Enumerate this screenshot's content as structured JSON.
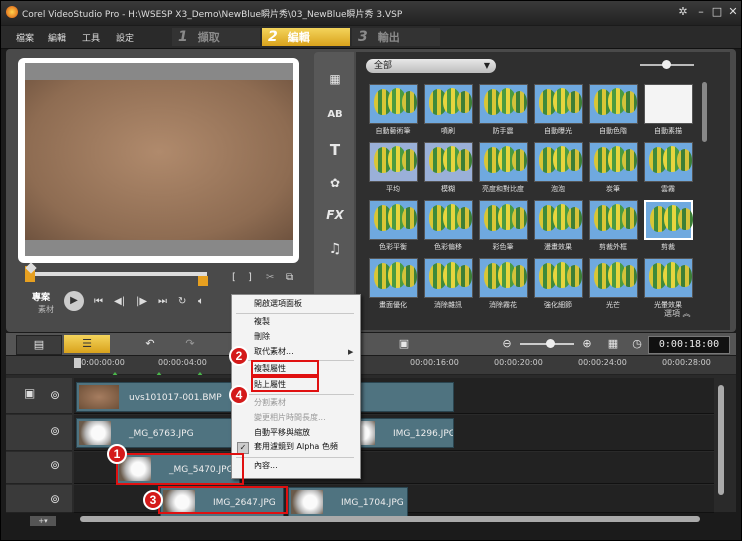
{
  "window": {
    "title": "Corel VideoStudio Pro - H:\\WSESP X3_Demo\\NewBlue瞬片秀\\03_NewBlue瞬片秀 3.VSP",
    "buttons": [
      "app-icon",
      "minimize-icon",
      "maximize-icon",
      "close-icon"
    ]
  },
  "menu": {
    "items": [
      "檔案",
      "編輯",
      "工具",
      "設定"
    ]
  },
  "steps": [
    {
      "num": "1",
      "label": "擷取",
      "active": false
    },
    {
      "num": "2",
      "label": "編輯",
      "active": true
    },
    {
      "num": "3",
      "label": "輸出",
      "active": false
    }
  ],
  "player": {
    "project_label": "專案",
    "clip_label": "素材",
    "controls": [
      "play-icon",
      "home-icon",
      "prev-frame-icon",
      "next-frame-icon",
      "end-icon",
      "repeat-icon",
      "volume-icon"
    ],
    "trim": [
      "[",
      "]"
    ]
  },
  "library": {
    "category": "全部",
    "side_tabs": [
      "video-icon",
      "transition-icon",
      "title-icon",
      "graphics-icon",
      "fx-icon",
      "audio-icon"
    ],
    "fx_label": "FX",
    "ab_label": "AB",
    "title_label": "T",
    "options_label": "選項",
    "effects": [
      [
        "自動藝術筆",
        "噴刷",
        "防手震",
        "自動曝光",
        "自動色階",
        "自動素描"
      ],
      [
        "平均",
        "模糊",
        "亮度和對比度",
        "泡泡",
        "炭筆",
        "雲霧"
      ],
      [
        "色彩平衡",
        "色彩偏移",
        "彩色筆",
        "漫畫效果",
        "剪裁外框",
        "剪裁"
      ],
      [
        "畫面優化",
        "消除雜訊",
        "消除霧花",
        "強化細節",
        "光芒",
        "光暈效果"
      ]
    ]
  },
  "timeline": {
    "timecode": "0:00:18:00",
    "ruler": [
      "00:00:00:00",
      "00:00:04:00",
      "00:00:16:00",
      "00:00:20:00",
      "00:00:24:00",
      "00:00:28:00"
    ],
    "tracks": {
      "video": "uvs101017-001.BMP",
      "overlay1": [
        "_MG_6763.JPG",
        "IMG_1296.JPG"
      ],
      "overlay2": [
        "_MG_5470.JPG"
      ],
      "overlay3": [
        "IMG_2647.JPG",
        "IMG_1704.JPG"
      ]
    }
  },
  "context_menu": {
    "items": [
      {
        "label": "開啟選項面板",
        "enabled": true
      },
      {
        "label": "複製",
        "enabled": true
      },
      {
        "label": "刪除",
        "enabled": true
      },
      {
        "label": "取代素材...",
        "enabled": true
      },
      {
        "label": "複製屬性",
        "enabled": true
      },
      {
        "label": "貼上屬性",
        "enabled": true
      },
      {
        "label": "分割素材",
        "enabled": false
      },
      {
        "label": "變更相片時間長度...",
        "enabled": false
      },
      {
        "label": "自動平移與縮放",
        "enabled": true
      },
      {
        "label": "套用濾鏡到 Alpha 色頻",
        "enabled": true
      },
      {
        "label": "內容...",
        "enabled": true
      }
    ]
  },
  "annotations": [
    "1",
    "2",
    "3",
    "4"
  ],
  "colors": {
    "accent": "#e7a020",
    "highlight": "#e01010",
    "clip": "#4f7380"
  }
}
